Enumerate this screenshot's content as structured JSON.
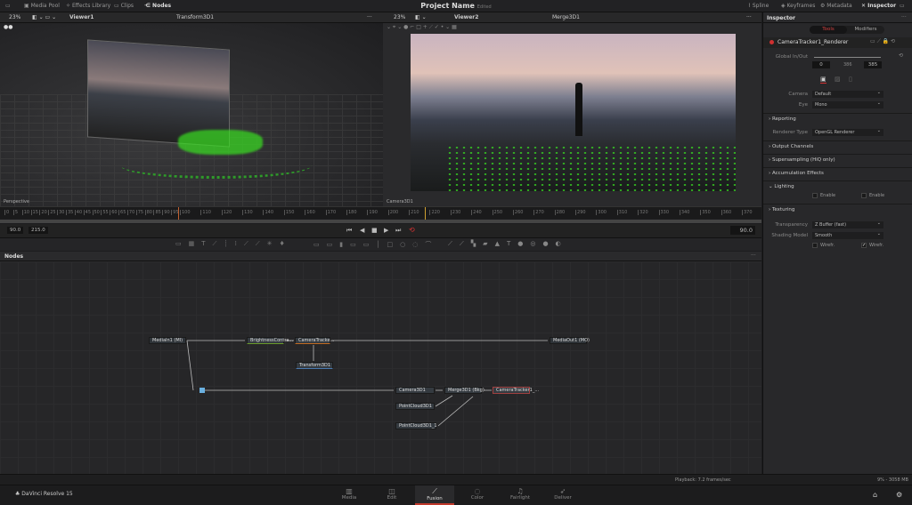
{
  "topbar": {
    "media_pool": "Media Pool",
    "effects_library": "Effects Library",
    "clips": "Clips",
    "nodes": "Nodes",
    "project_name": "Project Name",
    "project_status": "Edited",
    "spline": "Spline",
    "keyframes": "Keyframes",
    "metadata": "Metadata",
    "inspector": "Inspector"
  },
  "viewer1": {
    "zoom": "23%",
    "name": "Viewer1",
    "node": "Transform3D1",
    "view_label": "Perspective"
  },
  "viewer2": {
    "zoom": "23%",
    "name": "Viewer2",
    "node": "Merge3D1",
    "view_label": "Camera3D1"
  },
  "timeline": {
    "ticks": [
      "0",
      "5",
      "10",
      "15",
      "20",
      "25",
      "30",
      "35",
      "40",
      "45",
      "50",
      "55",
      "60",
      "65",
      "70",
      "75",
      "80",
      "85",
      "90",
      "95",
      "100",
      "110",
      "120",
      "130",
      "140",
      "150",
      "160",
      "170",
      "180",
      "190",
      "200",
      "210",
      "220",
      "230",
      "240",
      "250",
      "260",
      "270",
      "280",
      "290",
      "300",
      "310",
      "320",
      "330",
      "340",
      "350",
      "360",
      "370",
      "380"
    ],
    "start": "90.0",
    "end": "215.0",
    "current": "90.0"
  },
  "nodes": {
    "title": "Nodes",
    "items": [
      "MediaIn1 (MI)",
      "BrightnessContra...",
      "CameraTracke...",
      "Transform3D1",
      "MediaOut1 (MO)",
      "Camera3D1",
      "Merge3D1 (Bkg)",
      "CameraTracker1_...",
      "PointCloud3D1",
      "PointCloud3D1_1"
    ]
  },
  "inspector": {
    "title": "Inspector",
    "tab_tools": "Tools",
    "tab_modifiers": "Modifiers",
    "tool_name": "CameraTracker1_Renderer",
    "global_inout_label": "Global In/Out",
    "in": "0",
    "mid": "386",
    "out": "385",
    "camera_label": "Camera",
    "camera_value": "Default",
    "eye_label": "Eye",
    "eye_value": "Mono",
    "reporting": "Reporting",
    "renderer_type_label": "Renderer Type",
    "renderer_type_value": "OpenGL Renderer",
    "output_channels": "Output Channels",
    "supersampling": "Supersampling (HiQ only)",
    "accumulation": "Accumulation Effects",
    "lighting": "Lighting",
    "enable1": "Enable",
    "enable2": "Enable",
    "texturing": "Texturing",
    "transparency_label": "Transparency",
    "transparency_value": "Z Buffer (fast)",
    "shading_label": "Shading Model",
    "shading_value": "Smooth",
    "wireframe1": "Wirefr.",
    "wireframe2": "Wirefr.",
    "wireframe2_checked": true,
    "enable_checked": false
  },
  "status": {
    "playback": "Playback: 7.2 frames/sec",
    "memory": "9% - 3058 MB"
  },
  "pages": {
    "app": "DaVinci Resolve 15",
    "items": [
      "Media",
      "Edit",
      "Fusion",
      "Color",
      "Fairlight",
      "Deliver"
    ],
    "active": "Fusion"
  },
  "colors": {
    "accent": "#c0392b",
    "point_cloud": "#39e021"
  }
}
